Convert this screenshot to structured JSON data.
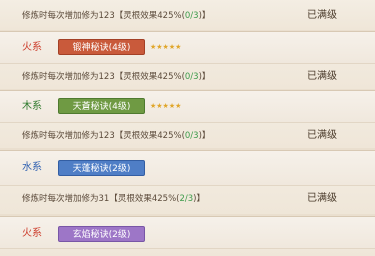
{
  "rows": [
    {
      "desc_main": "修炼时每次增加修为123",
      "desc_bonus": "灵根效果425%",
      "desc_frac": "0/3",
      "status": "已满级"
    },
    {
      "element": "火系",
      "element_type": "fire",
      "skill": "锻神秘诀(4级)",
      "stars": "★★★★★",
      "tag_color": "red",
      "desc_main": "修炼时每次增加修为123",
      "desc_bonus": "灵根效果425%",
      "desc_frac": "0/3",
      "status": "已满级"
    },
    {
      "element": "木系",
      "element_type": "wood",
      "skill": "天蒼秘诀(4级)",
      "stars": "★★★★★",
      "tag_color": "green",
      "desc_main": "修炼时每次增加修为123",
      "desc_bonus": "灵根效果425%",
      "desc_frac": "0/3",
      "status": "已满级"
    },
    {
      "element": "水系",
      "element_type": "water",
      "skill": "天蓬秘诀(2级)",
      "stars": "",
      "tag_color": "blue",
      "desc_main": "修炼时每次增加修为31",
      "desc_bonus": "灵根效果425%",
      "desc_frac": "2/3",
      "status": "已满级"
    },
    {
      "element": "火系",
      "element_type": "fire",
      "skill": "玄焰秘诀(2级)",
      "stars": "",
      "tag_color": "purple"
    }
  ],
  "colors": {
    "fire": "#cc3b2a",
    "wood": "#2f7a2d",
    "water": "#2e5fb0",
    "star": "#e0a62a",
    "fraction": "#3d9b4b"
  }
}
